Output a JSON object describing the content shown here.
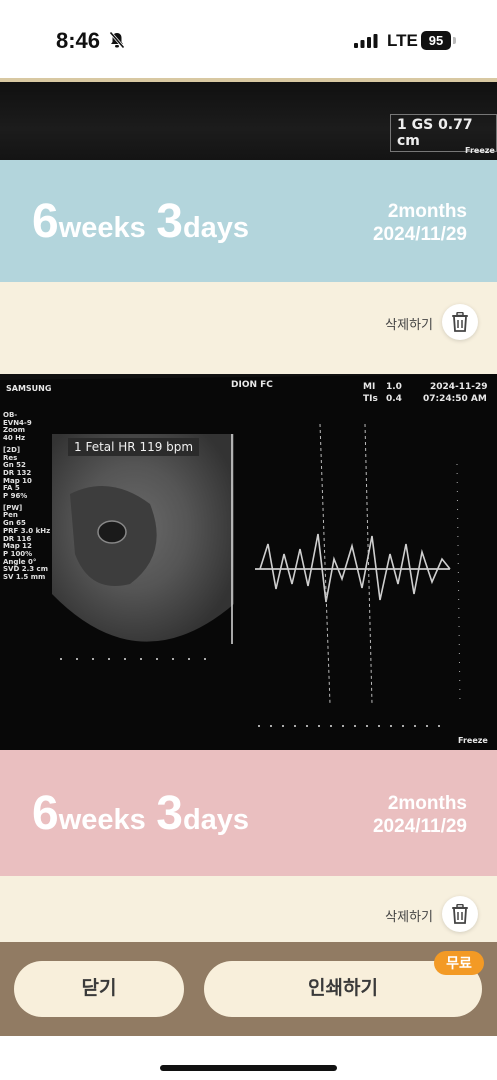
{
  "status_bar": {
    "time": "8:46",
    "network": "LTE",
    "battery": "95",
    "icons": [
      "bell-slash-icon",
      "signal-bars-icon"
    ]
  },
  "cards": [
    {
      "photo_texts": {
        "measurement": "1 GS  0.77 cm",
        "freeze": "Freeze"
      },
      "gestation": {
        "weeks_num": "6",
        "weeks_word": "weeks",
        "days_num": "3",
        "days_word": "days"
      },
      "months": "2months",
      "date": "2024/11/29",
      "banner_color": "#b3d5dc",
      "delete_label": "삭제하기",
      "delete_icon": "trash-icon"
    },
    {
      "photo_texts": {
        "brand": "SAMSUNG",
        "clinic": "DION FC",
        "mi_label": "MI",
        "mi_value": "1.0",
        "tis_label": "TIs",
        "tis_value": "0.4",
        "date": "2024-11-29",
        "time": "07:24:50 AM",
        "fhr": "1 Fetal HR  119 bpm",
        "freeze": "Freeze",
        "settings": [
          "OB-",
          "EVN4-9",
          "Zoom",
          "40 Hz",
          "",
          "[2D]",
          "Res",
          "Gn  52",
          "DR  132",
          "Map 10",
          "FA  5",
          "P   96%",
          "",
          "[PW]",
          "Pen",
          "Gn  65",
          "PRF 3.0 kHz",
          "DR  116",
          "Map 12",
          "P   100%",
          "Angle 0°",
          "SVD 2.3 cm",
          "SV  1.5 mm"
        ]
      },
      "gestation": {
        "weeks_num": "6",
        "weeks_word": "weeks",
        "days_num": "3",
        "days_word": "days"
      },
      "months": "2months",
      "date": "2024/11/29",
      "banner_color": "#eabfc0",
      "delete_label": "삭제하기",
      "delete_icon": "trash-icon"
    }
  ],
  "bottom": {
    "close_label": "닫기",
    "print_label": "인쇄하기",
    "free_badge": "무료"
  },
  "colors": {
    "page_bg": "#f7f0de",
    "bottom_bar": "#917b63",
    "button_bg": "#f8efdb",
    "badge": "#f39a25"
  }
}
